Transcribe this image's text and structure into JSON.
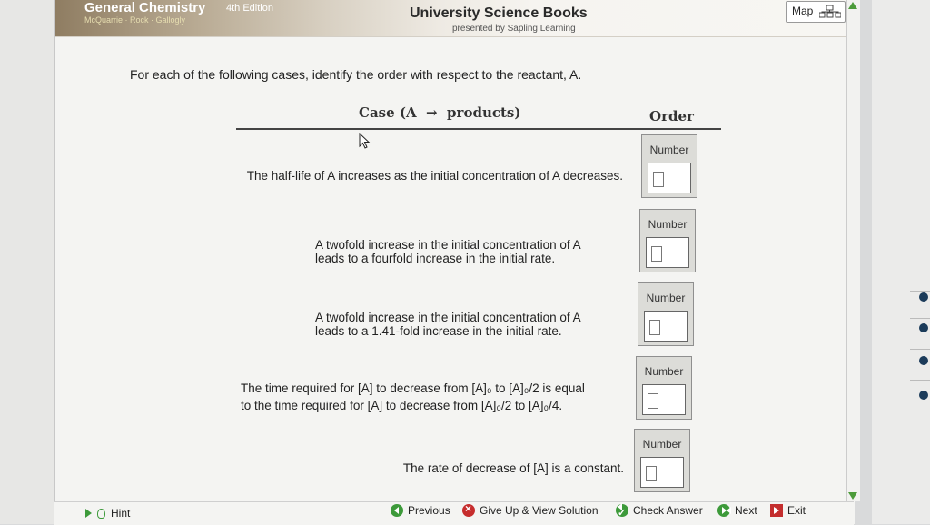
{
  "header": {
    "title": "General Chemistry",
    "edition": "4th Edition",
    "authors": "McQuarrie · Rock · Gallogly",
    "publisher": "University Science Books",
    "presented_by": "presented by Sapling Learning",
    "map_label": "Map"
  },
  "question": {
    "instructions": "For each of the following cases, identify the order with respect to the reactant, A.",
    "column_case": "Case (A  →  products)",
    "column_order": "Order",
    "field_label": "Number",
    "cases": [
      {
        "line1": "The half-life of A increases as the initial concentration of A decreases.",
        "line2": "",
        "answer": ""
      },
      {
        "line1": "A twofold increase in the initial concentration of A",
        "line2": "leads to a fourfold increase in the initial rate.",
        "answer": ""
      },
      {
        "line1": "A twofold increase in the initial concentration of A",
        "line2": "leads to a 1.41-fold increase in the initial rate.",
        "answer": ""
      },
      {
        "line1": "The time required for [A] to decrease from [A]₀ to [A]₀/2 is equal",
        "line2": "to the time required for [A] to decrease from [A]₀/2 to [A]₀/4.",
        "answer": ""
      },
      {
        "line1": "The rate of decrease of [A] is a constant.",
        "line2": "",
        "answer": ""
      }
    ]
  },
  "footer": {
    "hint": "Hint",
    "previous": "Previous",
    "give_up": "Give Up & View Solution",
    "check_answer": "Check Answer",
    "next": "Next",
    "exit": "Exit"
  },
  "colors": {
    "accent_green": "#3d9a3a",
    "give_up_red": "#c62d2d",
    "header_brown": "#8f7d62"
  },
  "icons": [
    "map-icon",
    "cursor-icon",
    "hint-arrow-icon",
    "lightbulb-icon",
    "previous-icon",
    "give-up-icon",
    "check-icon",
    "next-icon",
    "exit-icon",
    "scroll-up-icon",
    "scroll-down-icon"
  ]
}
